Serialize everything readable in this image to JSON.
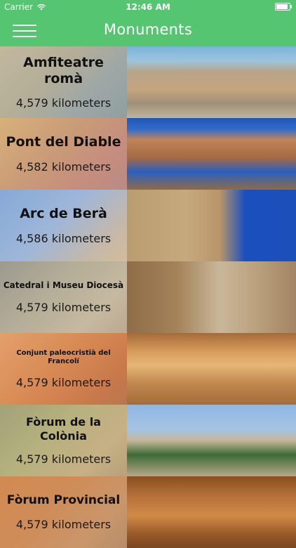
{
  "status_bar": {
    "carrier": "Carrier",
    "time": "12:46 AM"
  },
  "navbar": {
    "title": "Monuments",
    "menu_icon": "hamburger-menu-icon",
    "color": "#55c571"
  },
  "monuments": [
    {
      "name": "Amfiteatre romà",
      "distance": "4,579 kilometers"
    },
    {
      "name": "Pont del Diable",
      "distance": "4,582 kilometers"
    },
    {
      "name": "Arc de Berà",
      "distance": "4,586 kilometers"
    },
    {
      "name": "Catedral i Museu Diocesà",
      "distance": "4,579 kilometers"
    },
    {
      "name": "Conjunt paleocristià del Francolí",
      "distance": "4,579 kilometers"
    },
    {
      "name": "Fòrum de la Colònia",
      "distance": "4,579 kilometers"
    },
    {
      "name": "Fòrum Provincial",
      "distance": "4,579 kilometers"
    }
  ]
}
